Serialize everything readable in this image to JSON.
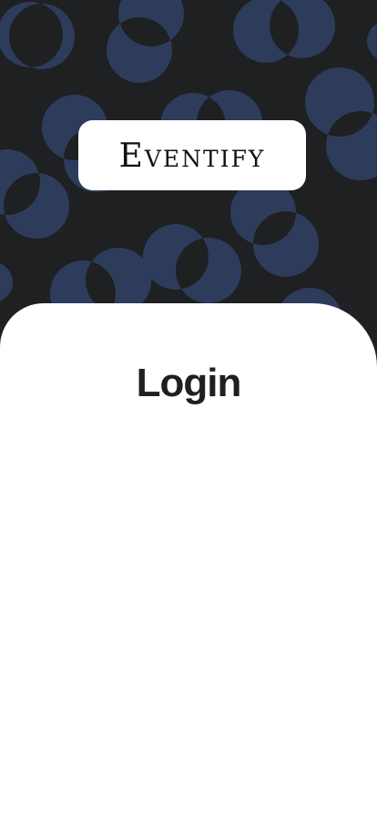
{
  "app": {
    "logo_text": "Eventify"
  },
  "login": {
    "title": "Login"
  },
  "colors": {
    "background": "#1e2022",
    "pattern": "#2e3c5c",
    "sheet": "#ffffff",
    "text": "#1e1f21"
  }
}
